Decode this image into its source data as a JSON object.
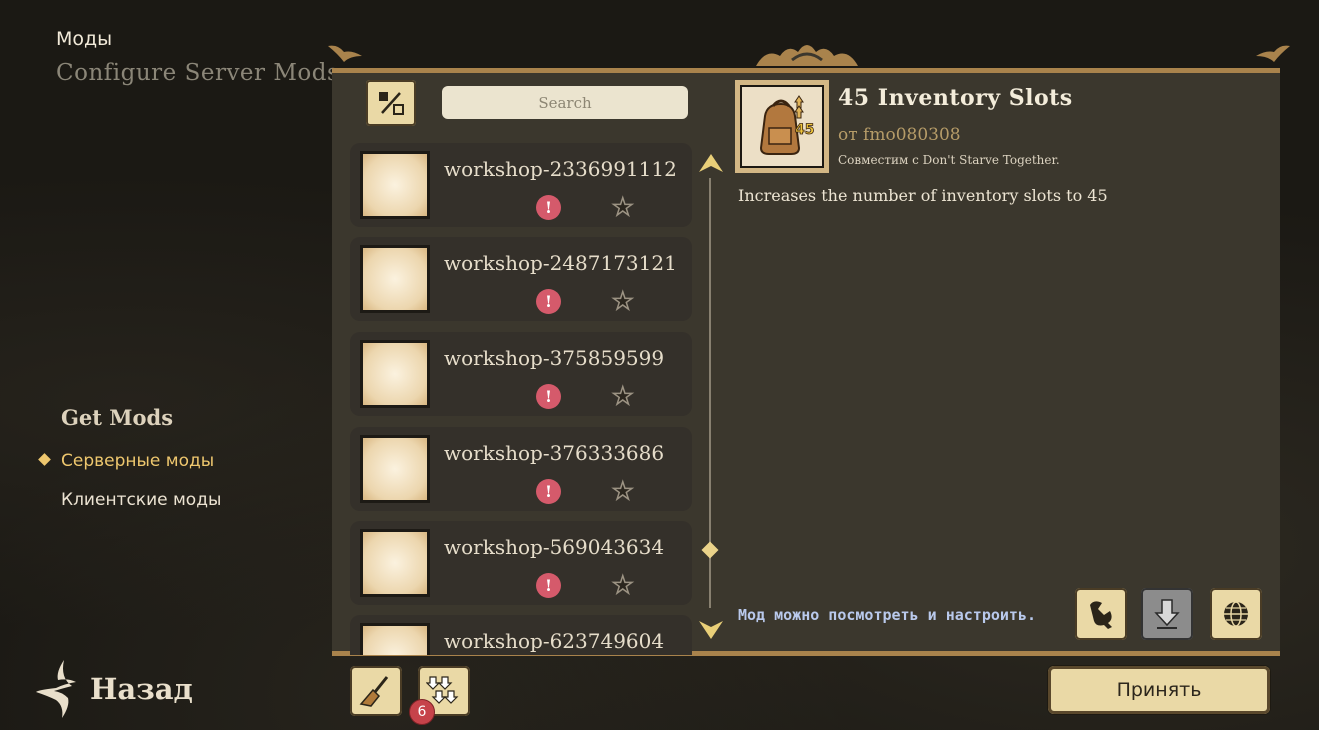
{
  "header": {
    "title": "Моды",
    "subtitle": "Configure Server Mods"
  },
  "sidebar": {
    "heading": "Get Mods",
    "items": [
      {
        "label": "Серверные моды",
        "active": true
      },
      {
        "label": "Клиентские моды",
        "active": false
      }
    ]
  },
  "back": {
    "label": "Назад"
  },
  "search": {
    "placeholder": "Search"
  },
  "mods": [
    {
      "name": "workshop-2336991112"
    },
    {
      "name": "workshop-2487173121"
    },
    {
      "name": "workshop-375859599"
    },
    {
      "name": "workshop-376333686"
    },
    {
      "name": "workshop-569043634"
    },
    {
      "name": "workshop-623749604"
    }
  ],
  "detail": {
    "title": "45 Inventory Slots",
    "author": "от fmo080308",
    "compat": "Совместим с Don't Starve Together.",
    "description": "Increases the number of inventory slots to 45",
    "icon_number": "45",
    "status": "Мод можно посмотреть и настроить."
  },
  "footer": {
    "update_count": "6",
    "accept_label": "Принять"
  },
  "colors": {
    "accent": "#eec76e",
    "panel": "#3b372d",
    "button": "#ead9a6",
    "warn": "#d55a6b"
  },
  "icons": {
    "filter": "filter-icon",
    "warn": "exclamation-icon",
    "star": "star-icon",
    "configure": "wrench-icon",
    "download": "download-icon",
    "web": "globe-icon",
    "clean": "broom-icon",
    "update": "update-all-icon",
    "back": "back-arrow-icon"
  }
}
